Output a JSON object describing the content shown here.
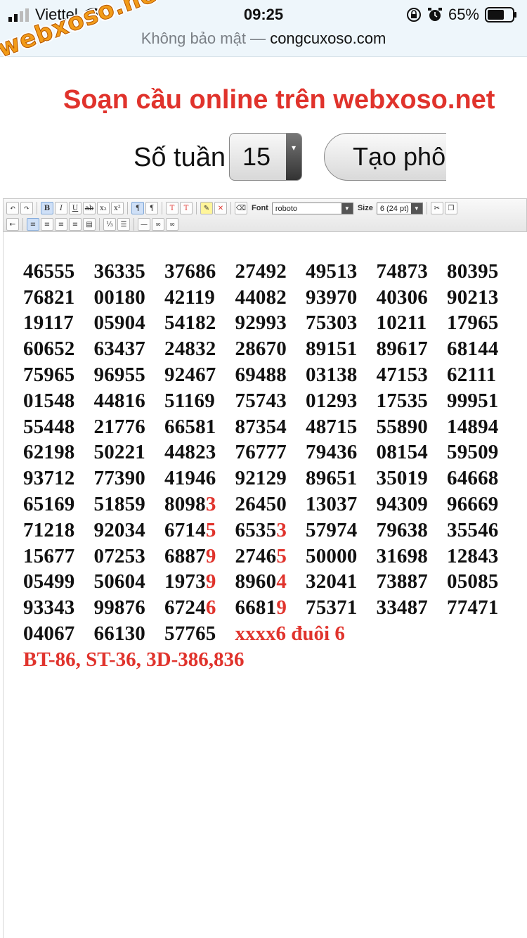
{
  "status_bar": {
    "carrier": "Viettel",
    "time": "09:25",
    "battery": "65%",
    "icons": [
      "signal-icon",
      "wifi-icon",
      "rotation-lock-icon",
      "alarm-icon",
      "battery-icon"
    ]
  },
  "address_bar": {
    "security": "Không bảo mật —",
    "host": "congcuxoso.com"
  },
  "watermark": "webxoso.net",
  "page": {
    "title": "Soạn cầu online trên webxoso.net",
    "week_label": "Số tuần",
    "week_value": "15",
    "create_button": "Tạo phôi"
  },
  "toolbar": {
    "font_label": "Font",
    "font_value": "roboto",
    "size_label": "Size",
    "size_value": "6 (24 pt)"
  },
  "grid": {
    "rows": [
      [
        {
          "main": "46555",
          "tail": ""
        },
        {
          "main": "36335",
          "tail": ""
        },
        {
          "main": "37686",
          "tail": ""
        },
        {
          "main": "27492",
          "tail": ""
        },
        {
          "main": "49513",
          "tail": ""
        },
        {
          "main": "74873",
          "tail": ""
        },
        {
          "main": "80395",
          "tail": ""
        }
      ],
      [
        {
          "main": "76821",
          "tail": ""
        },
        {
          "main": "00180",
          "tail": ""
        },
        {
          "main": "42119",
          "tail": ""
        },
        {
          "main": "44082",
          "tail": ""
        },
        {
          "main": "93970",
          "tail": ""
        },
        {
          "main": "40306",
          "tail": ""
        },
        {
          "main": "90213",
          "tail": ""
        }
      ],
      [
        {
          "main": "19117",
          "tail": ""
        },
        {
          "main": "05904",
          "tail": ""
        },
        {
          "main": "54182",
          "tail": ""
        },
        {
          "main": "92993",
          "tail": ""
        },
        {
          "main": "75303",
          "tail": ""
        },
        {
          "main": "10211",
          "tail": ""
        },
        {
          "main": "17965",
          "tail": ""
        }
      ],
      [
        {
          "main": "60652",
          "tail": ""
        },
        {
          "main": "63437",
          "tail": ""
        },
        {
          "main": "24832",
          "tail": ""
        },
        {
          "main": "28670",
          "tail": ""
        },
        {
          "main": "89151",
          "tail": ""
        },
        {
          "main": "89617",
          "tail": ""
        },
        {
          "main": "68144",
          "tail": ""
        }
      ],
      [
        {
          "main": "75965",
          "tail": ""
        },
        {
          "main": "96955",
          "tail": ""
        },
        {
          "main": "92467",
          "tail": ""
        },
        {
          "main": "69488",
          "tail": ""
        },
        {
          "main": "03138",
          "tail": ""
        },
        {
          "main": "47153",
          "tail": ""
        },
        {
          "main": "62111",
          "tail": ""
        }
      ],
      [
        {
          "main": "01548",
          "tail": ""
        },
        {
          "main": "44816",
          "tail": ""
        },
        {
          "main": "51169",
          "tail": ""
        },
        {
          "main": "75743",
          "tail": ""
        },
        {
          "main": "01293",
          "tail": ""
        },
        {
          "main": "17535",
          "tail": ""
        },
        {
          "main": "99951",
          "tail": ""
        }
      ],
      [
        {
          "main": "55448",
          "tail": ""
        },
        {
          "main": "21776",
          "tail": ""
        },
        {
          "main": "66581",
          "tail": ""
        },
        {
          "main": "87354",
          "tail": ""
        },
        {
          "main": "48715",
          "tail": ""
        },
        {
          "main": "55890",
          "tail": ""
        },
        {
          "main": "14894",
          "tail": ""
        }
      ],
      [
        {
          "main": "62198",
          "tail": ""
        },
        {
          "main": "50221",
          "tail": ""
        },
        {
          "main": "44823",
          "tail": ""
        },
        {
          "main": "76777",
          "tail": ""
        },
        {
          "main": "79436",
          "tail": ""
        },
        {
          "main": "08154",
          "tail": ""
        },
        {
          "main": "59509",
          "tail": ""
        }
      ],
      [
        {
          "main": "93712",
          "tail": ""
        },
        {
          "main": "77390",
          "tail": ""
        },
        {
          "main": "41946",
          "tail": ""
        },
        {
          "main": "92129",
          "tail": ""
        },
        {
          "main": "89651",
          "tail": ""
        },
        {
          "main": "35019",
          "tail": ""
        },
        {
          "main": "64668",
          "tail": ""
        }
      ],
      [
        {
          "main": "65169",
          "tail": ""
        },
        {
          "main": "51859",
          "tail": ""
        },
        {
          "main": "8098",
          "tail": "3"
        },
        {
          "main": "26450",
          "tail": ""
        },
        {
          "main": "13037",
          "tail": ""
        },
        {
          "main": "94309",
          "tail": ""
        },
        {
          "main": "96669",
          "tail": ""
        }
      ],
      [
        {
          "main": "71218",
          "tail": ""
        },
        {
          "main": "92034",
          "tail": ""
        },
        {
          "main": "6714",
          "tail": "5"
        },
        {
          "main": "6535",
          "tail": "3"
        },
        {
          "main": "57974",
          "tail": ""
        },
        {
          "main": "79638",
          "tail": ""
        },
        {
          "main": "35546",
          "tail": ""
        }
      ],
      [
        {
          "main": "15677",
          "tail": ""
        },
        {
          "main": "07253",
          "tail": ""
        },
        {
          "main": "6887",
          "tail": "9"
        },
        {
          "main": "2746",
          "tail": "5"
        },
        {
          "main": "50000",
          "tail": ""
        },
        {
          "main": "31698",
          "tail": ""
        },
        {
          "main": "12843",
          "tail": ""
        }
      ],
      [
        {
          "main": "05499",
          "tail": ""
        },
        {
          "main": "50604",
          "tail": ""
        },
        {
          "main": "1973",
          "tail": "9"
        },
        {
          "main": "8960",
          "tail": "4"
        },
        {
          "main": "32041",
          "tail": ""
        },
        {
          "main": "73887",
          "tail": ""
        },
        {
          "main": "05085",
          "tail": ""
        }
      ],
      [
        {
          "main": "93343",
          "tail": ""
        },
        {
          "main": "99876",
          "tail": ""
        },
        {
          "main": "6724",
          "tail": "6"
        },
        {
          "main": "6681",
          "tail": "9"
        },
        {
          "main": "75371",
          "tail": ""
        },
        {
          "main": "33487",
          "tail": ""
        },
        {
          "main": "77471",
          "tail": ""
        }
      ]
    ],
    "last_row": [
      {
        "main": "04067",
        "tail": ""
      },
      {
        "main": "66130",
        "tail": ""
      },
      {
        "main": "57765",
        "tail": ""
      }
    ],
    "note": "xxxx6 đuôi 6",
    "summary": "BT-86, ST-36, 3D-386,836"
  },
  "colors": {
    "accent_red": "#e0332c",
    "topbar_bg": "#eef6fb",
    "watermark_orange": "#f29b18"
  }
}
